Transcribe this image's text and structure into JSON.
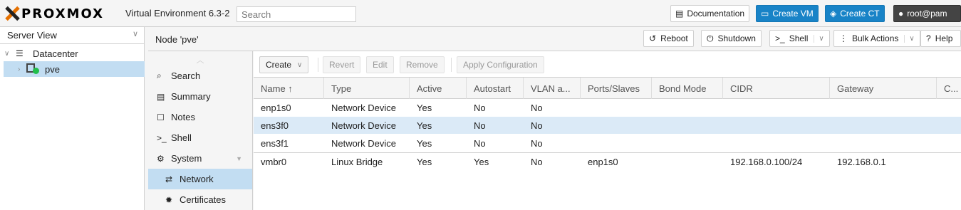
{
  "brand": {
    "logo": "PROXMOX",
    "version": "Virtual Environment 6.3-2"
  },
  "search": {
    "placeholder": "Search"
  },
  "topbar": {
    "documentation": "Documentation",
    "create_vm": "Create VM",
    "create_ct": "Create CT",
    "user": "root@pam",
    "accent": "#1883c7"
  },
  "sidebar": {
    "view": "Server View",
    "tree": [
      {
        "label": "Datacenter",
        "icon": "server-rack-icon"
      },
      {
        "label": "pve",
        "icon": "node-online-icon",
        "selected": true
      }
    ]
  },
  "node": {
    "title": "Node 'pve'",
    "buttons": {
      "reboot": "Reboot",
      "shutdown": "Shutdown",
      "shell": "Shell",
      "bulk": "Bulk Actions",
      "help": "Help"
    }
  },
  "menu": {
    "items": [
      {
        "label": "Search",
        "icon": "search-icon"
      },
      {
        "label": "Summary",
        "icon": "book-icon"
      },
      {
        "label": "Notes",
        "icon": "note-icon"
      },
      {
        "label": "Shell",
        "icon": "terminal-icon"
      },
      {
        "label": "System",
        "icon": "cogs-icon"
      },
      {
        "label": "Network",
        "icon": "exchange-icon",
        "selected": true
      },
      {
        "label": "Certificates",
        "icon": "certificate-icon"
      }
    ]
  },
  "toolbar": {
    "create": "Create",
    "revert": "Revert",
    "edit": "Edit",
    "remove": "Remove",
    "apply": "Apply Configuration"
  },
  "grid": {
    "columns": [
      "Name ↑",
      "Type",
      "Active",
      "Autostart",
      "VLAN a...",
      "Ports/Slaves",
      "Bond Mode",
      "CIDR",
      "Gateway",
      "C..."
    ],
    "rows": [
      [
        "enp1s0",
        "Network Device",
        "Yes",
        "No",
        "No",
        "",
        "",
        "",
        ""
      ],
      [
        "ens3f0",
        "Network Device",
        "Yes",
        "No",
        "No",
        "",
        "",
        "",
        ""
      ],
      [
        "ens3f1",
        "Network Device",
        "Yes",
        "No",
        "No",
        "",
        "",
        "",
        ""
      ],
      [
        "vmbr0",
        "Linux Bridge",
        "Yes",
        "Yes",
        "No",
        "enp1s0",
        "",
        "192.168.0.100/24",
        "192.168.0.1"
      ]
    ]
  }
}
